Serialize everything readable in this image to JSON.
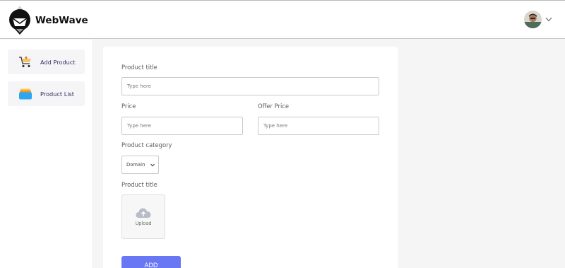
{
  "header": {
    "brand": "WebWave",
    "icons": {
      "logo": "tag-envelope-logo",
      "avatar": "user-avatar",
      "dropdown": "chevron-down-icon"
    }
  },
  "sidebar": {
    "items": [
      {
        "label": "Add Product",
        "icon": "cart-add-icon"
      },
      {
        "label": "Product List",
        "icon": "stack-list-icon"
      }
    ]
  },
  "form": {
    "title_label": "Product title",
    "title_placeholder": "Type here",
    "price_label": "Price",
    "price_placeholder": "Type here",
    "offer_label": "Offer Price",
    "offer_placeholder": "Type here",
    "category_label": "Product category",
    "category_selected": "Domain",
    "image_label": "Product title",
    "upload_label": "Upload",
    "submit_label": "ADD"
  },
  "colors": {
    "accent": "#6a77f5",
    "sidebar_text": "#3b2a5c",
    "page_bg": "#f5f5f5"
  }
}
